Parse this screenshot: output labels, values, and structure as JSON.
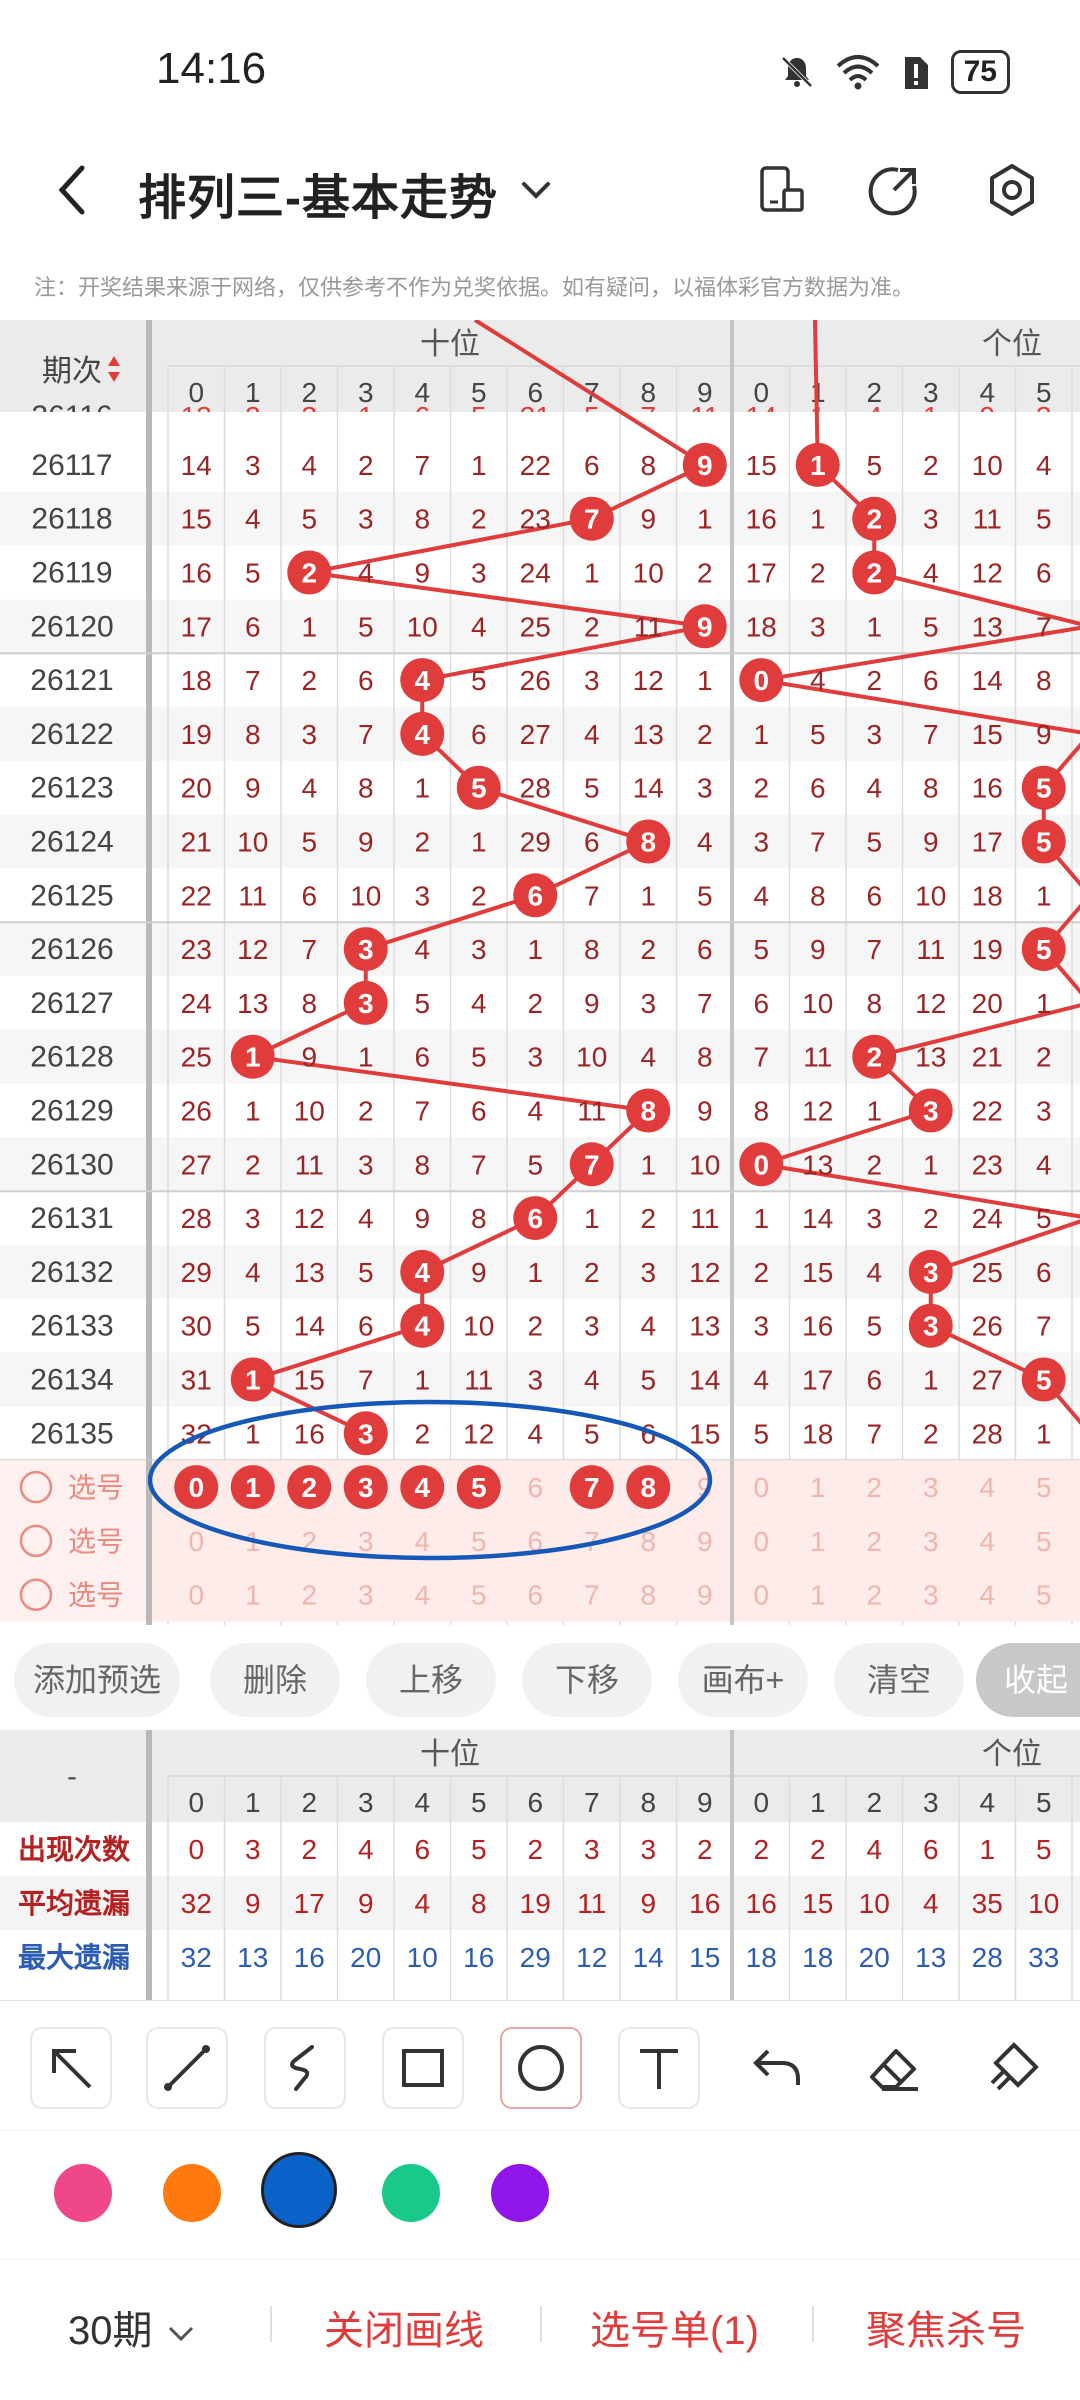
{
  "status": {
    "time": "14:16",
    "battery": "75"
  },
  "header": {
    "title": "排列三-基本走势"
  },
  "note": "注：开奖结果来源于网络，仅供参考不作为兑奖依据。如有疑问，以福体彩官方数据为准。",
  "grid": {
    "period_header": "期次",
    "tens_label": "十位",
    "ones_label": "个位",
    "digits": [
      "0",
      "1",
      "2",
      "3",
      "4",
      "5",
      "6",
      "7",
      "8",
      "9"
    ],
    "ones_digits_visible": [
      "0",
      "1",
      "2",
      "3",
      "4",
      "5"
    ],
    "partial_top_row": {
      "tens": [
        "13",
        "2",
        "3",
        "1",
        "6",
        "5",
        "21",
        "5",
        "7",
        "11"
      ],
      "ones": [
        "14",
        "1",
        "4",
        "1",
        "9",
        "3"
      ]
    },
    "rows": [
      {
        "period": "26117",
        "tens": [
          "14",
          "3",
          "4",
          "2",
          "7",
          "1",
          "22",
          "6",
          "8",
          "9"
        ],
        "tens_hit": 9,
        "ones": [
          "15",
          "1",
          "5",
          "2",
          "10",
          "4"
        ],
        "ones_hit": 1
      },
      {
        "period": "26118",
        "tens": [
          "15",
          "4",
          "5",
          "3",
          "8",
          "2",
          "23",
          "7",
          "9",
          "1"
        ],
        "tens_hit": 7,
        "ones": [
          "16",
          "1",
          "2",
          "3",
          "11",
          "5"
        ],
        "ones_hit": 2
      },
      {
        "period": "26119",
        "tens": [
          "16",
          "5",
          "2",
          "4",
          "9",
          "3",
          "24",
          "1",
          "10",
          "2"
        ],
        "tens_hit": 2,
        "ones": [
          "17",
          "2",
          "2",
          "4",
          "12",
          "6"
        ],
        "ones_hit": 2
      },
      {
        "period": "26120",
        "tens": [
          "17",
          "6",
          "1",
          "5",
          "10",
          "4",
          "25",
          "2",
          "11",
          "9"
        ],
        "tens_hit": 9,
        "ones": [
          "18",
          "3",
          "1",
          "5",
          "13",
          "7"
        ],
        "ones_hit": -1
      },
      {
        "period": "26121",
        "tens": [
          "18",
          "7",
          "2",
          "6",
          "4",
          "5",
          "26",
          "3",
          "12",
          "1"
        ],
        "tens_hit": 4,
        "ones": [
          "0",
          "4",
          "2",
          "6",
          "14",
          "8"
        ],
        "ones_hit": 0
      },
      {
        "period": "26122",
        "tens": [
          "19",
          "8",
          "3",
          "7",
          "4",
          "6",
          "27",
          "4",
          "13",
          "2"
        ],
        "tens_hit": 4,
        "ones": [
          "1",
          "5",
          "3",
          "7",
          "15",
          "9"
        ],
        "ones_hit": -1
      },
      {
        "period": "26123",
        "tens": [
          "20",
          "9",
          "4",
          "8",
          "1",
          "5",
          "28",
          "5",
          "14",
          "3"
        ],
        "tens_hit": 5,
        "ones": [
          "2",
          "6",
          "4",
          "8",
          "16",
          "5"
        ],
        "ones_hit": 5
      },
      {
        "period": "26124",
        "tens": [
          "21",
          "10",
          "5",
          "9",
          "2",
          "1",
          "29",
          "6",
          "8",
          "4"
        ],
        "tens_hit": 8,
        "ones": [
          "3",
          "7",
          "5",
          "9",
          "17",
          "5"
        ],
        "ones_hit": 5
      },
      {
        "period": "26125",
        "tens": [
          "22",
          "11",
          "6",
          "10",
          "3",
          "2",
          "6",
          "7",
          "1",
          "5"
        ],
        "tens_hit": 6,
        "ones": [
          "4",
          "8",
          "6",
          "10",
          "18",
          "1"
        ],
        "ones_hit": -1
      },
      {
        "period": "26126",
        "tens": [
          "23",
          "12",
          "7",
          "3",
          "4",
          "3",
          "1",
          "8",
          "2",
          "6"
        ],
        "tens_hit": 3,
        "ones": [
          "5",
          "9",
          "7",
          "11",
          "19",
          "5"
        ],
        "ones_hit": 5
      },
      {
        "period": "26127",
        "tens": [
          "24",
          "13",
          "8",
          "3",
          "5",
          "4",
          "2",
          "9",
          "3",
          "7"
        ],
        "tens_hit": 3,
        "ones": [
          "6",
          "10",
          "8",
          "12",
          "20",
          "1"
        ],
        "ones_hit": -1
      },
      {
        "period": "26128",
        "tens": [
          "25",
          "1",
          "9",
          "1",
          "6",
          "5",
          "3",
          "10",
          "4",
          "8"
        ],
        "tens_hit": 1,
        "ones": [
          "7",
          "11",
          "2",
          "13",
          "21",
          "2"
        ],
        "ones_hit": 2
      },
      {
        "period": "26129",
        "tens": [
          "26",
          "1",
          "10",
          "2",
          "7",
          "6",
          "4",
          "11",
          "8",
          "9"
        ],
        "tens_hit": 8,
        "ones": [
          "8",
          "12",
          "1",
          "3",
          "22",
          "3"
        ],
        "ones_hit": 3
      },
      {
        "period": "26130",
        "tens": [
          "27",
          "2",
          "11",
          "3",
          "8",
          "7",
          "5",
          "7",
          "1",
          "10"
        ],
        "tens_hit": 7,
        "ones": [
          "0",
          "13",
          "2",
          "1",
          "23",
          "4"
        ],
        "ones_hit": 0
      },
      {
        "period": "26131",
        "tens": [
          "28",
          "3",
          "12",
          "4",
          "9",
          "8",
          "6",
          "1",
          "2",
          "11"
        ],
        "tens_hit": 6,
        "ones": [
          "1",
          "14",
          "3",
          "2",
          "24",
          "5"
        ],
        "ones_hit": -1
      },
      {
        "period": "26132",
        "tens": [
          "29",
          "4",
          "13",
          "5",
          "4",
          "9",
          "1",
          "2",
          "3",
          "12"
        ],
        "tens_hit": 4,
        "ones": [
          "2",
          "15",
          "4",
          "3",
          "25",
          "6"
        ],
        "ones_hit": 3
      },
      {
        "period": "26133",
        "tens": [
          "30",
          "5",
          "14",
          "6",
          "4",
          "10",
          "2",
          "3",
          "4",
          "13"
        ],
        "tens_hit": 4,
        "ones": [
          "3",
          "16",
          "5",
          "3",
          "26",
          "7"
        ],
        "ones_hit": 3
      },
      {
        "period": "26134",
        "tens": [
          "31",
          "1",
          "15",
          "7",
          "1",
          "11",
          "3",
          "4",
          "5",
          "14"
        ],
        "tens_hit": 1,
        "ones": [
          "4",
          "17",
          "6",
          "1",
          "27",
          "5"
        ],
        "ones_hit": 5
      },
      {
        "period": "26135",
        "tens": [
          "32",
          "1",
          "16",
          "3",
          "2",
          "12",
          "4",
          "5",
          "6",
          "15"
        ],
        "tens_hit": 3,
        "ones": [
          "5",
          "18",
          "7",
          "2",
          "28",
          "1"
        ],
        "ones_hit": -1
      }
    ],
    "pick_label": "选号",
    "pick_rows": [
      {
        "tens_selected": [
          0,
          1,
          2,
          3,
          4,
          5,
          7,
          8
        ],
        "ones_selected": []
      },
      {
        "tens_selected": [],
        "ones_selected": []
      },
      {
        "tens_selected": [],
        "ones_selected": []
      }
    ]
  },
  "buttons": [
    "添加预选",
    "删除",
    "上移",
    "下移",
    "画布+",
    "清空",
    "收起"
  ],
  "stats": {
    "header_dash": "-",
    "rows": [
      {
        "label": "出现次数",
        "color": "#b52020",
        "tens": [
          "0",
          "3",
          "2",
          "4",
          "6",
          "5",
          "2",
          "3",
          "3",
          "2"
        ],
        "ones": [
          "2",
          "2",
          "4",
          "6",
          "1",
          "5"
        ]
      },
      {
        "label": "平均遗漏",
        "color": "#b52020",
        "tens": [
          "32",
          "9",
          "17",
          "9",
          "4",
          "8",
          "19",
          "11",
          "9",
          "16"
        ],
        "ones": [
          "16",
          "15",
          "10",
          "4",
          "35",
          "10"
        ]
      },
      {
        "label": "最大遗漏",
        "color": "#2d5db3",
        "tens": [
          "32",
          "13",
          "16",
          "20",
          "10",
          "16",
          "29",
          "12",
          "14",
          "15"
        ],
        "ones": [
          "18",
          "18",
          "20",
          "13",
          "28",
          "33"
        ]
      }
    ]
  },
  "tools": [
    "arrow-tool",
    "line-tool",
    "curve-tool",
    "rect-tool",
    "circle-tool",
    "text-tool",
    "undo-tool",
    "eraser-tool",
    "clear-tool"
  ],
  "palette": [
    "#f0478a",
    "#ff7a0e",
    "#0b63c9",
    "#19c98a",
    "#8f16e8"
  ],
  "bottom": {
    "period_select": "30期",
    "close_draw": "关闭画线",
    "pick_list": "选号单(1)",
    "focus_kill": "聚焦杀号"
  }
}
